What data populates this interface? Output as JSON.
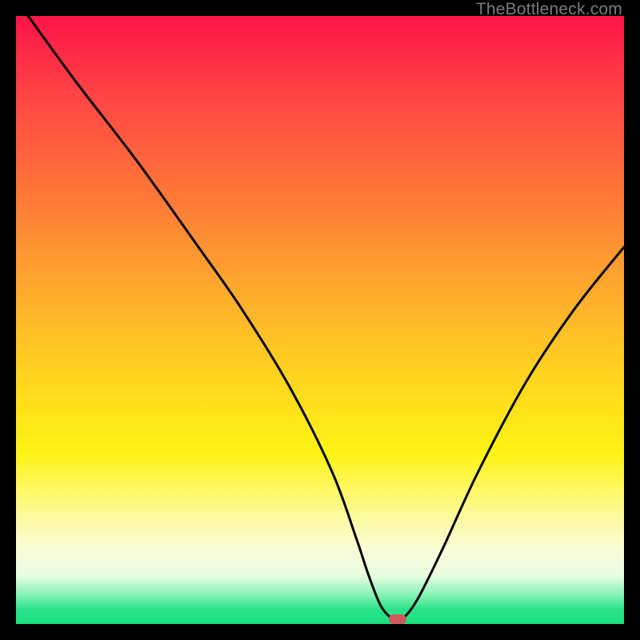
{
  "watermark": "TheBottleneck.com",
  "colors": {
    "frame_bg": "#000000",
    "marker": "#cf5959",
    "curve": "#000000"
  },
  "chart_data": {
    "type": "line",
    "title": "",
    "xlabel": "",
    "ylabel": "",
    "xlim": [
      0,
      100
    ],
    "ylim": [
      0,
      100
    ],
    "x": [
      2,
      10,
      20,
      30,
      37,
      45,
      52,
      56,
      58,
      60,
      62,
      63.5,
      66,
      70,
      76,
      84,
      92,
      100
    ],
    "values": [
      100,
      89,
      76,
      62,
      52,
      39,
      25,
      14,
      8,
      3,
      0.8,
      0.8,
      4,
      12,
      25,
      40,
      52,
      62
    ],
    "marker": {
      "x": 62.7,
      "y": 0.8
    },
    "notes": "V-shaped bottleneck curve; minimum around x≈63; axes and units not shown in image."
  }
}
